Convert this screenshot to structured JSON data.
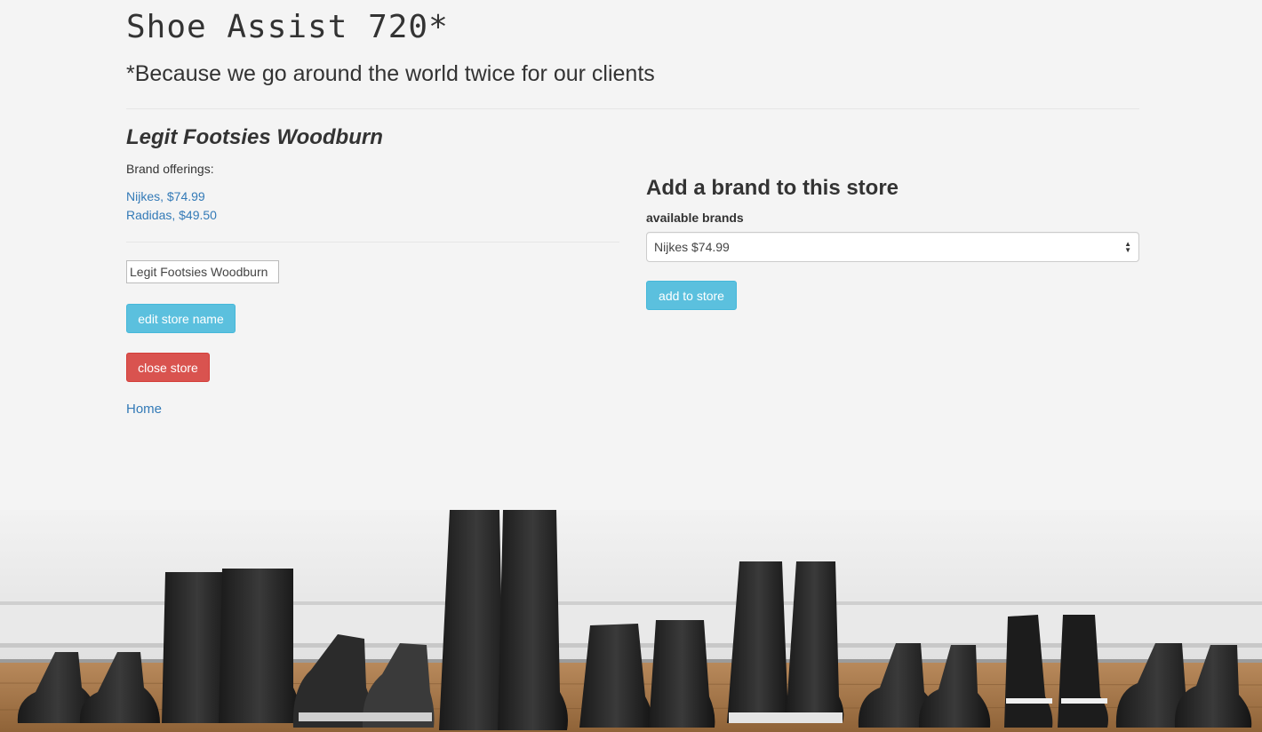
{
  "header": {
    "title": "Shoe Assist 720*",
    "tagline": "*Because we go around the world twice for our clients"
  },
  "store": {
    "name": "Legit Footsies Woodburn",
    "offerings_label": "Brand offerings:",
    "brands": [
      {
        "label": "Nijkes, $74.99"
      },
      {
        "label": "Radidas, $49.50"
      }
    ],
    "name_input_value": "Legit Footsies Woodburn",
    "edit_button": "edit store name",
    "close_button": "close store",
    "home_link": "Home"
  },
  "add_brand": {
    "heading": "Add a brand to this store",
    "select_label": "available brands",
    "selected_option": "Nijkes $74.99",
    "add_button": "add to store"
  },
  "colors": {
    "background": "#f4f4f4",
    "link": "#337ab7",
    "info_button": "#5bc0de",
    "danger_button": "#d9534f"
  }
}
